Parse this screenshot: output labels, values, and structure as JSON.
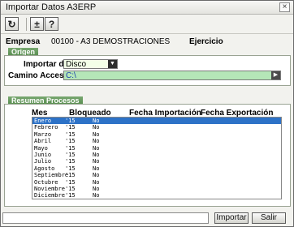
{
  "window": {
    "title": "Importar Datos A3ERP",
    "close_glyph": "×"
  },
  "toolbar": {
    "refresh_glyph": "↻",
    "plusminus_glyph": "±",
    "help_glyph": "?"
  },
  "header": {
    "empresa_label": "Empresa",
    "empresa_value": "00100 - A3 DEMOSTRACIONES",
    "ejercicio_label": "Ejercicio"
  },
  "origen": {
    "section_title": "Origen",
    "importar_label": "Importar de",
    "importar_value": "Disco",
    "camino_label": "Camino Acceso",
    "camino_value": "C:\\"
  },
  "resumen": {
    "section_title": "Resumen Procesos",
    "columns": [
      "Mes",
      "Bloqueado",
      "Fecha Importación",
      "Fecha Exportación"
    ],
    "rows": [
      {
        "mes": "Enero",
        "year": "'15",
        "bloqueado": "No"
      },
      {
        "mes": "Febrero",
        "year": "'15",
        "bloqueado": "No"
      },
      {
        "mes": "Marzo",
        "year": "'15",
        "bloqueado": "No"
      },
      {
        "mes": "Abril",
        "year": "'15",
        "bloqueado": "No"
      },
      {
        "mes": "Mayo",
        "year": "'15",
        "bloqueado": "No"
      },
      {
        "mes": "Junio",
        "year": "'15",
        "bloqueado": "No"
      },
      {
        "mes": "Julio",
        "year": "'15",
        "bloqueado": "No"
      },
      {
        "mes": "Agosto",
        "year": "'15",
        "bloqueado": "No"
      },
      {
        "mes": "Septiembre",
        "year": "'15",
        "bloqueado": "No"
      },
      {
        "mes": "Octubre",
        "year": "'15",
        "bloqueado": "No"
      },
      {
        "mes": "Noviembre",
        "year": "'15",
        "bloqueado": "No"
      },
      {
        "mes": "Diciembre",
        "year": "'15",
        "bloqueado": "No"
      }
    ],
    "selected_row": "Enero"
  },
  "footer": {
    "importar_label": "Importar",
    "salir_label": "Salir"
  },
  "colors": {
    "section_tab": "#548a4b",
    "selection": "#2d72c7",
    "path_field": "#b5e6b8"
  }
}
